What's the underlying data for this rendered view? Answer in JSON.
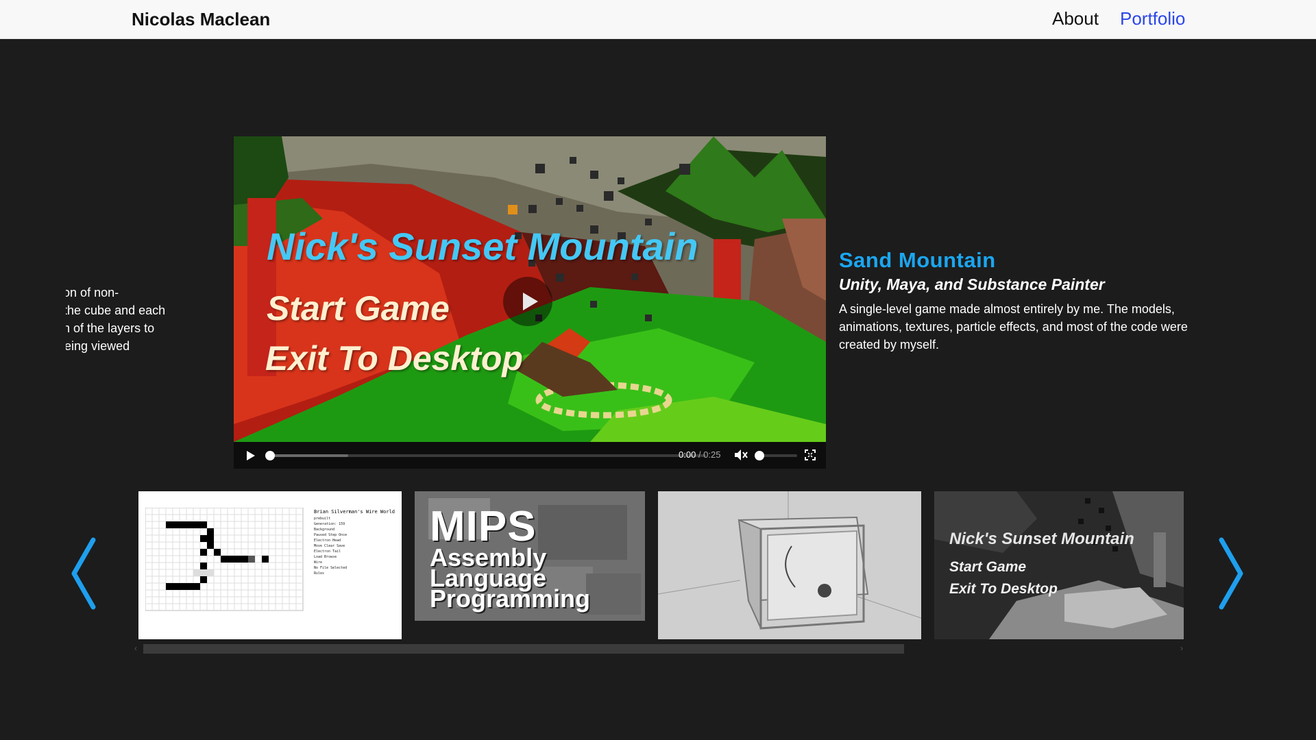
{
  "nav": {
    "brand": "Nicolas Maclean",
    "links": [
      {
        "label": "About",
        "active": false
      },
      {
        "label": "Portfolio",
        "active": true
      }
    ]
  },
  "video": {
    "menu_title": "Nick's Sunset Mountain",
    "menu_start": "Start Game",
    "menu_exit": "Exit To Desktop",
    "current_time": "0:00",
    "duration": "/ 0:25",
    "progress": 0,
    "buffered_fraction": 0.18,
    "muted": true,
    "volume": 0
  },
  "previous_project": {
    "description": "he illusion of non-\n; within the cube and each\nse which of the layers to\ne was being viewed"
  },
  "current_project": {
    "title": "Sand Mountain",
    "subtitle": "Unity, Maya, and Substance Painter",
    "description": "A single-level game made almost entirely by me. The models, animations, textures, particle effects, and most of the code were created by myself."
  },
  "thumbnails": [
    {
      "name": "wire-world",
      "title": "Brian Silverman's Wire World",
      "panel": [
        "prebuilt",
        "Generation: 159",
        "Background",
        "Paused  Step Once",
        "Electron Head",
        "Move  Clear  Save",
        "Electron Tail",
        "Load  Browse",
        "Wire",
        "No File Selected",
        "Rules"
      ]
    },
    {
      "name": "mips-assembly",
      "line1": "MIPS",
      "line2": "Assembly",
      "line3": "Language",
      "line4": "Programming"
    },
    {
      "name": "cube-3d"
    },
    {
      "name": "sunset-mountain",
      "title": "Nick's Sunset Mountain",
      "start": "Start Game",
      "exit": "Exit To Desktop"
    }
  ],
  "colors": {
    "background": "#1c1c1c",
    "navbar": "#f8f8f8",
    "accent_link": "#2b46e8",
    "project_title": "#1ba6f0",
    "arrow": "#1e9fee"
  },
  "icons": {
    "carousel_prev": "chevron-left-icon",
    "carousel_next": "chevron-right-icon",
    "video_play": "play-icon",
    "mute": "volume-muted-icon",
    "fullscreen": "fullscreen-icon"
  }
}
